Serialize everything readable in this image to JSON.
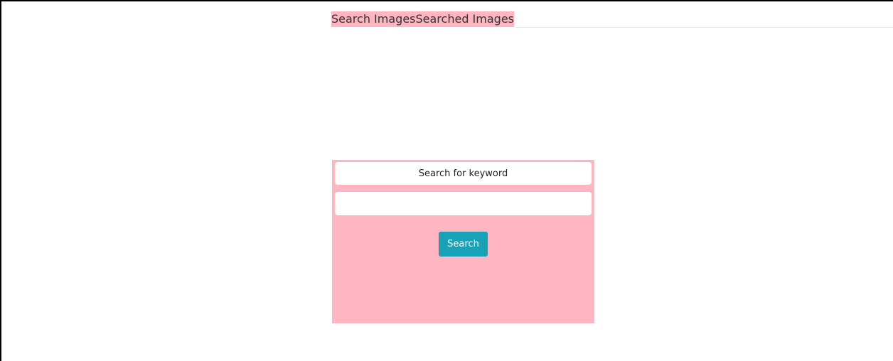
{
  "nav": {
    "links": [
      {
        "label": "Search Images"
      },
      {
        "label": "Searched Images"
      }
    ]
  },
  "search_form": {
    "label": "Search for keyword",
    "input_value": "",
    "input_placeholder": "",
    "button_label": "Search"
  },
  "colors": {
    "accent_pink": "#ffb6c1",
    "button_teal": "#17a2b8"
  }
}
